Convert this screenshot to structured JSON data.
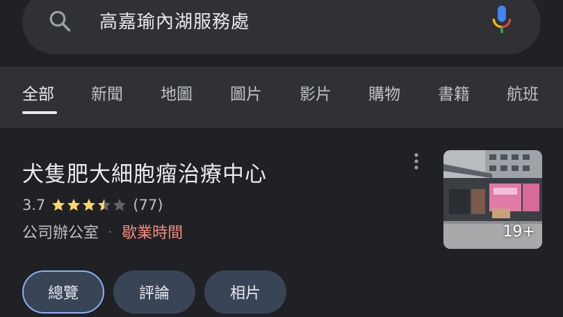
{
  "search": {
    "query": "高嘉瑜內湖服務處"
  },
  "tabs": [
    {
      "label": "全部",
      "active": true
    },
    {
      "label": "新聞"
    },
    {
      "label": "地圖"
    },
    {
      "label": "圖片"
    },
    {
      "label": "影片"
    },
    {
      "label": "購物"
    },
    {
      "label": "書籍"
    },
    {
      "label": "航班"
    }
  ],
  "result": {
    "title": "犬隻肥大細胞瘤治療中心",
    "rating": "3.7",
    "rating_value": 3.7,
    "review_count": "(77)",
    "category": "公司辦公室",
    "separator": "·",
    "hours_label": "歇業時間",
    "photo_count": "19+"
  },
  "chips": [
    {
      "label": "總覽",
      "active": true
    },
    {
      "label": "評論"
    },
    {
      "label": "相片"
    }
  ],
  "colors": {
    "background": "#202124",
    "tab_bar": "#303134",
    "star": "#fdd663",
    "star_empty": "#5f6368",
    "hours": "#f28b82",
    "chip_bg": "#394457",
    "chip_active_border": "#8ab4f8"
  }
}
